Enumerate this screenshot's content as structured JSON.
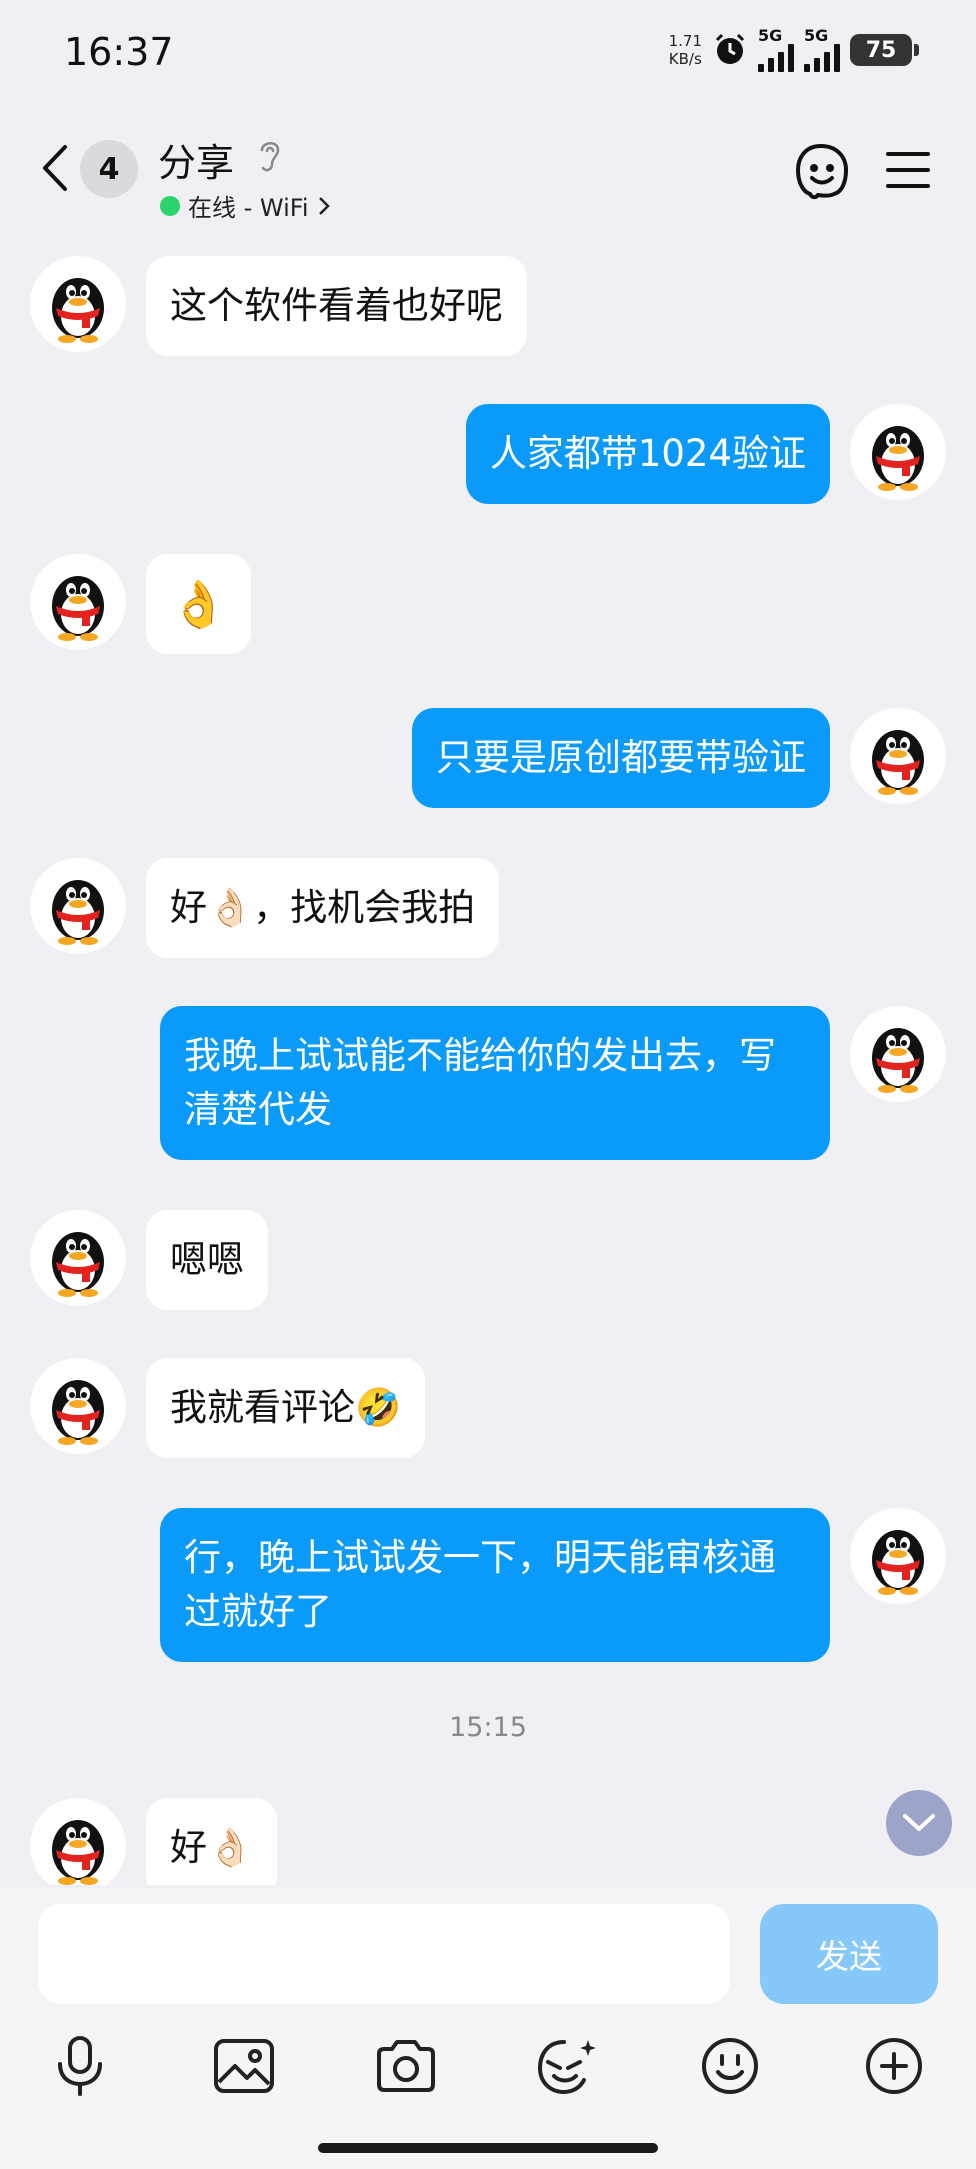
{
  "status_bar": {
    "time": "16:37",
    "net_speed_value": "1.71",
    "net_speed_unit": "KB/s",
    "signal_1_label": "5G",
    "signal_2_label": "5G",
    "battery": "75"
  },
  "header": {
    "unread_count": "4",
    "title": "分享",
    "status": "在线 - WiFi",
    "status_color": "#2bd56c"
  },
  "chat": {
    "messages": [
      {
        "side": "left",
        "text": "这个软件看着也好呢"
      },
      {
        "side": "right",
        "text": "人家都带1024验证"
      },
      {
        "side": "left",
        "text": "👌"
      },
      {
        "side": "right",
        "text": "只要是原创都要带验证"
      },
      {
        "side": "left",
        "text": "好👌🏻，找机会我拍"
      },
      {
        "side": "right",
        "text": "我晚上试试能不能给你的发出去，写清楚代发"
      },
      {
        "side": "left",
        "text": "嗯嗯"
      },
      {
        "side": "left",
        "text": "我就看评论🤣"
      },
      {
        "side": "right",
        "text": "行，晚上试试发一下，明天能审核通过就好了"
      },
      {
        "side": "left",
        "text": "好👌🏻"
      }
    ],
    "time_divider": "15:15",
    "outgoing_bubble_color": "#0a9af9",
    "incoming_bubble_color": "#ffffff"
  },
  "input_bar": {
    "placeholder": "",
    "send_label": "发送",
    "tools": [
      "microphone-icon",
      "image-icon",
      "camera-icon",
      "sticker-icon",
      "emoji-icon",
      "plus-icon"
    ]
  }
}
